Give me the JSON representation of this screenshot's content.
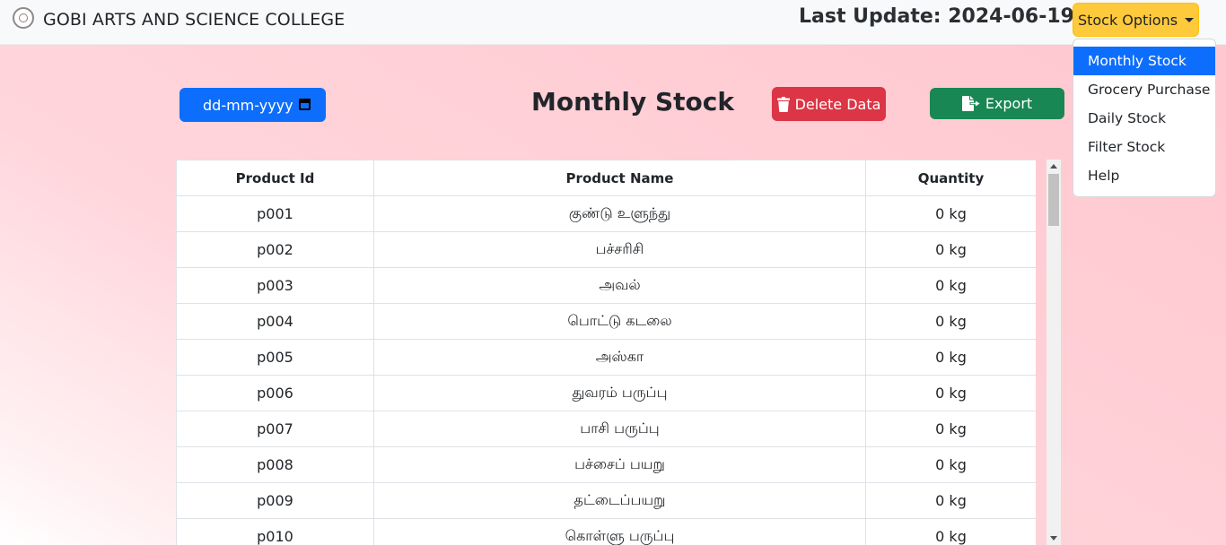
{
  "navbar": {
    "brand": "GOBI ARTS AND SCIENCE COLLEGE",
    "last_update": "Last Update: 2024-06-19",
    "stock_button": "Stock Options"
  },
  "dropdown": {
    "items": [
      {
        "label": "Monthly Stock",
        "active": true
      },
      {
        "label": "Grocery Purchase"
      },
      {
        "label": "Daily Stock"
      },
      {
        "label": "Filter Stock"
      },
      {
        "label": "Help"
      }
    ]
  },
  "toolbar": {
    "date_placeholder": "dd-mm-yyyy",
    "title": "Monthly Stock",
    "delete_label": "Delete Data",
    "export_label": "Export"
  },
  "table": {
    "headers": [
      "Product Id",
      "Product Name",
      "Quantity"
    ],
    "rows": [
      [
        "p001",
        "குண்டு உளுந்து",
        "0 kg"
      ],
      [
        "p002",
        "பச்சரிசி",
        "0 kg"
      ],
      [
        "p003",
        "அவல்",
        "0 kg"
      ],
      [
        "p004",
        "பொட்டு கடலை",
        "0 kg"
      ],
      [
        "p005",
        "அஸ்கா",
        "0 kg"
      ],
      [
        "p006",
        "துவரம் பருப்பு",
        "0 kg"
      ],
      [
        "p007",
        "பாசி பருப்பு",
        "0 kg"
      ],
      [
        "p008",
        "பச்சைப் பயறு",
        "0 kg"
      ],
      [
        "p009",
        "தட்டைப்பயறு",
        "0 kg"
      ],
      [
        "p010",
        "கொள்ளு பருப்பு",
        "0 kg"
      ]
    ]
  },
  "colors": {
    "primary": "#0d6efd",
    "danger": "#dc3545",
    "success": "#198754",
    "warning": "#ffc93c"
  }
}
